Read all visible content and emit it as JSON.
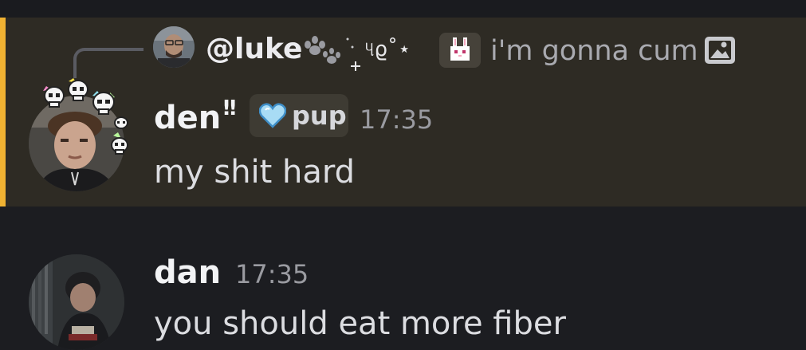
{
  "reply": {
    "author": "@luke",
    "deco_text": "୳ϱ˚⋆",
    "content": "i'm gonna cum"
  },
  "messages": [
    {
      "author": "den",
      "author_suffix": "‼",
      "tag": {
        "label": "pup",
        "icon": "blue-heart-icon"
      },
      "time": "17:35",
      "content": "my shit hard",
      "highlighted": true
    },
    {
      "author": "dan",
      "time": "17:35",
      "content": "you should eat more fiber"
    }
  ],
  "colors": {
    "background": "#1c1d21",
    "highlight_background": "#2e2b24",
    "highlight_bar": "#f0b232",
    "timestamp": "#9a9ba1",
    "reply_text": "#a9aab0"
  }
}
